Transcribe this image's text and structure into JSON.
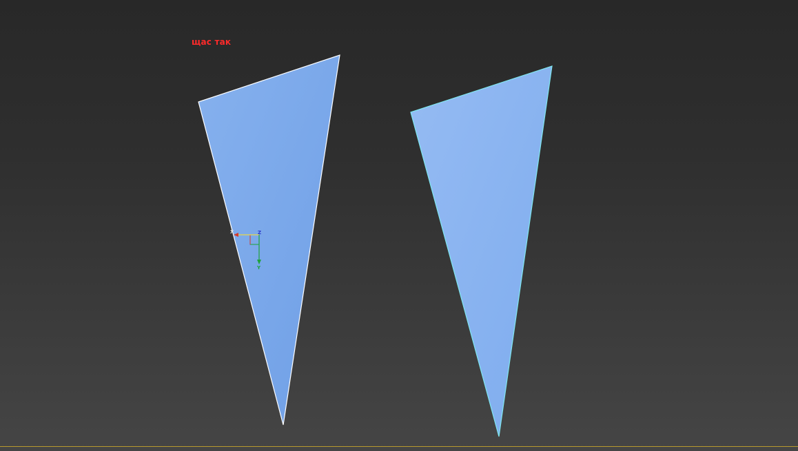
{
  "viewport": {
    "background_top": "#282828",
    "background_bottom": "#454545",
    "annotation_text": "щас так",
    "annotation_color": "#ff2a2a"
  },
  "objects": [
    {
      "name": "left-triangle",
      "fill": "#7aa8ea",
      "edge": "#ffffff",
      "selected": true
    },
    {
      "name": "right-triangle",
      "fill": "#8ab4f0",
      "edge": "#7fe7f0",
      "selected": false
    }
  ],
  "gizmo": {
    "x_label": "X",
    "y_label": "Y",
    "z_label": "Z",
    "x_color": "#d63b2a",
    "y_color": "#1fa33a",
    "z_color": "#2a35c8"
  },
  "timeline_line_color": "#b89a2e"
}
